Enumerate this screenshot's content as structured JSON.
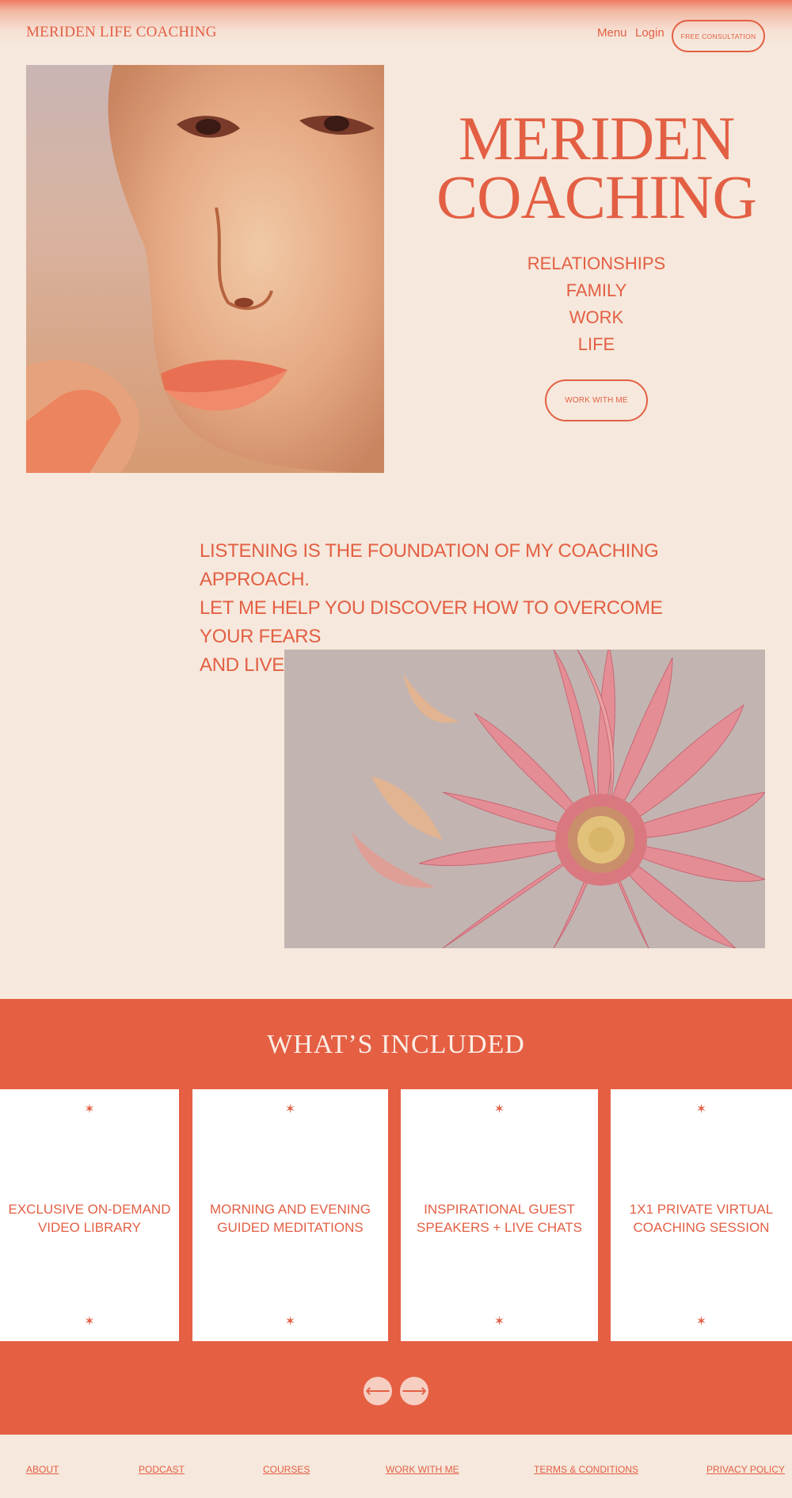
{
  "header": {
    "logo": "MERIDEN LIFE COACHING",
    "nav_menu": "Menu",
    "nav_login": "Login",
    "consult_button": "FREE CONSULTATION"
  },
  "hero": {
    "title_line1": "MERIDEN",
    "title_line2": "COACHING",
    "items": [
      "RELATIONSHIPS",
      "FAMILY",
      "WORK",
      "LIFE"
    ],
    "cta": "WORK WITH ME"
  },
  "intro": {
    "line1": "LISTENING IS THE FOUNDATION OF MY COACHING APPROACH.",
    "line2": "LET ME HELP YOU DISCOVER HOW TO OVERCOME YOUR FEARS",
    "line3": "AND LIVE THE LIFE YOU DESERVE."
  },
  "included": {
    "title": "WHAT’S INCLUDED",
    "star": "✶",
    "cards": [
      {
        "line1": "EXCLUSIVE ON-DEMAND",
        "line2": "VIDEO LIBRARY"
      },
      {
        "line1": "MORNING AND EVENING",
        "line2": "GUIDED MEDITATIONS"
      },
      {
        "line1": "INSPIRATIONAL GUEST",
        "line2": "SPEAKERS + LIVE CHATS"
      },
      {
        "line1": "1X1 PRIVATE VIRTUAL",
        "line2": "COACHING SESSION"
      }
    ],
    "prev": "⟵",
    "next": "⟶"
  },
  "footer": {
    "links": [
      "ABOUT",
      "PODCAST",
      "COURSES",
      "WORK WITH ME",
      "TERMS & CONDITIONS",
      "PRIVACY POLICY"
    ]
  },
  "colors": {
    "accent": "#e35f44",
    "background": "#f6e8dc",
    "band": "#e55f43"
  }
}
